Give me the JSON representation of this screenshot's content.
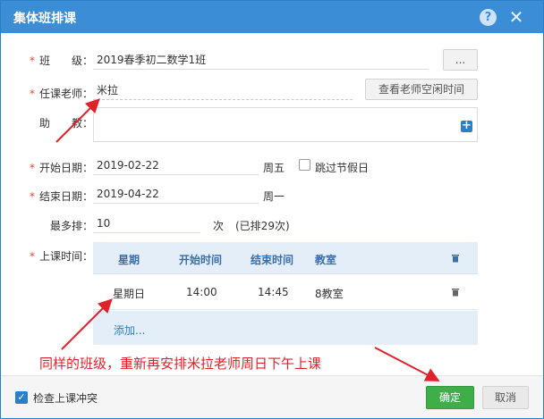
{
  "window": {
    "title": "集体班排课"
  },
  "form": {
    "class": {
      "label": "班　　级：",
      "value": "2019春季初二数学1班",
      "more_label": "..."
    },
    "teacher": {
      "label": "任课老师：",
      "value": "米拉",
      "check_free_label": "查看老师空闲时间"
    },
    "assistant": {
      "label": "助　　教："
    },
    "start_date": {
      "label": "开始日期：",
      "value": "2019-02-22",
      "weekday": "周五",
      "skip_holiday_label": "跳过节假日"
    },
    "end_date": {
      "label": "结束日期：",
      "value": "2019-04-22",
      "weekday": "周一"
    },
    "max": {
      "label": "最多排：",
      "value": "10",
      "unit": "次",
      "note": "(已排29次)"
    },
    "schedule": {
      "label": "上课时间：",
      "columns": {
        "weekday": "星期",
        "start": "开始时间",
        "end": "结束时间",
        "room": "教室"
      },
      "rows": [
        {
          "weekday": "星期日",
          "start": "14:00",
          "end": "14:45",
          "room": "8教室"
        }
      ],
      "add_label": "添加..."
    }
  },
  "annotation": {
    "text": "同样的班级，重新再安排米拉老师周日下午上课"
  },
  "footer": {
    "check_conflict_label": "检查上课冲突",
    "ok_label": "确定",
    "cancel_label": "取消"
  },
  "colors": {
    "title_bar": "#3b8ed6",
    "ok_button": "#3fae49",
    "annotation": "#e0222b",
    "required": "#e0473b"
  }
}
